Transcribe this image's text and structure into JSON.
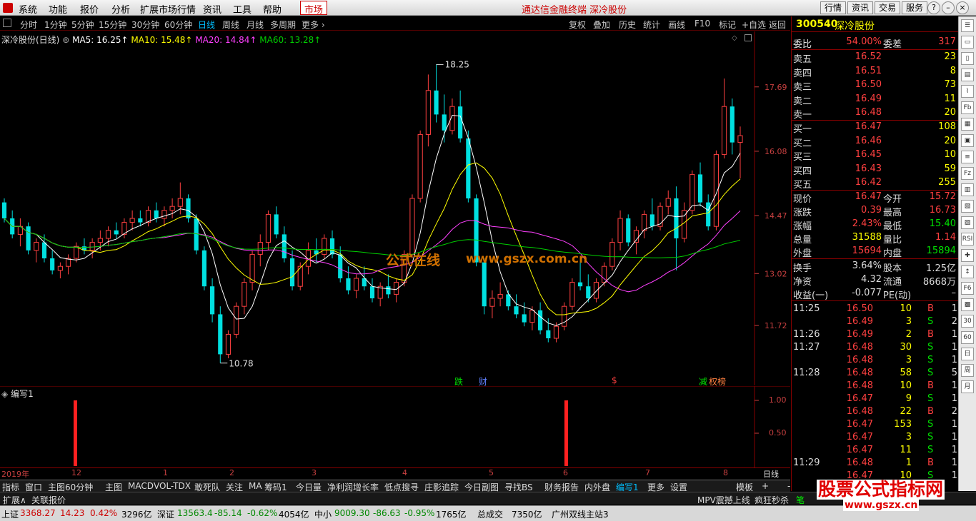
{
  "menu": [
    "系统",
    "功能",
    "报价",
    "分析",
    "扩展市场行情",
    "资讯",
    "工具",
    "帮助"
  ],
  "market_label": "市场",
  "window_title": "通达信金融终端  深冷股份",
  "top_right_buttons": [
    "行情",
    "资讯",
    "交易",
    "服务"
  ],
  "window_controls": [
    "?",
    "–",
    "□",
    "×"
  ],
  "periods": [
    "分时",
    "1分钟",
    "5分钟",
    "15分钟",
    "30分钟",
    "60分钟",
    "日线",
    "周线",
    "月线",
    "多周期",
    "更多 ›"
  ],
  "active_period": "日线",
  "chart_tools": [
    "复权",
    "叠加",
    "历史",
    "统计",
    "画线",
    "F10",
    "标记",
    "+自选",
    "返回"
  ],
  "ma_header": {
    "name": "深冷股份(日线)",
    "ma5": "MA5: 16.25↑",
    "ma10": "MA10: 15.48↑",
    "ma20": "MA20: 14.84↑",
    "ma60": "MA60: 13.28↑"
  },
  "colors": {
    "up": "#ff4040",
    "down": "#00e0e0",
    "ma5": "#ffffff",
    "ma10": "#ffff00",
    "ma20": "#ff40ff",
    "ma60": "#00d000",
    "axis": "#c84040",
    "accent": "#00bfff"
  },
  "chart_data": {
    "type": "candlestick",
    "price_axis_labels": [
      "17.69",
      "16.08",
      "14.47",
      "13.02",
      "11.72"
    ],
    "price_axis_values": [
      17.69,
      16.08,
      14.47,
      13.02,
      11.72
    ],
    "ylim": [
      10.4,
      18.9
    ],
    "high_annotation": "18.25",
    "low_annotation": "10.78",
    "x_month_labels": [
      "2019年",
      "12",
      "1",
      "2",
      "3",
      "4",
      "5",
      "6",
      "7",
      "8"
    ],
    "event_markers": [
      "跌",
      "财",
      "$",
      "减",
      "权榜"
    ],
    "candles_ohlc": [
      [
        14.8,
        14.9,
        14.3,
        14.4
      ],
      [
        14.4,
        14.6,
        13.9,
        14.0
      ],
      [
        14.0,
        14.4,
        13.7,
        14.2
      ],
      [
        14.2,
        14.3,
        13.5,
        13.6
      ],
      [
        13.6,
        13.9,
        13.3,
        13.8
      ],
      [
        13.8,
        14.0,
        13.3,
        13.4
      ],
      [
        13.4,
        13.6,
        13.0,
        13.1
      ],
      [
        13.1,
        13.3,
        12.9,
        13.2
      ],
      [
        13.2,
        13.5,
        13.0,
        13.4
      ],
      [
        13.4,
        13.8,
        13.3,
        13.7
      ],
      [
        13.7,
        13.9,
        13.5,
        13.6
      ],
      [
        13.6,
        13.9,
        13.4,
        13.8
      ],
      [
        13.8,
        14.1,
        13.6,
        13.9
      ],
      [
        13.9,
        14.2,
        13.7,
        14.1
      ],
      [
        14.1,
        14.3,
        13.9,
        14.0
      ],
      [
        14.0,
        14.4,
        13.9,
        14.3
      ],
      [
        14.3,
        14.6,
        14.1,
        14.4
      ],
      [
        14.4,
        14.6,
        14.2,
        14.3
      ],
      [
        14.3,
        14.7,
        14.2,
        14.6
      ],
      [
        14.6,
        14.8,
        14.3,
        14.4
      ],
      [
        14.4,
        14.7,
        14.2,
        14.6
      ],
      [
        14.6,
        14.9,
        14.4,
        14.7
      ],
      [
        14.7,
        15.3,
        14.5,
        14.9
      ],
      [
        14.9,
        15.0,
        14.3,
        14.4
      ],
      [
        14.4,
        14.5,
        13.5,
        13.6
      ],
      [
        13.6,
        13.7,
        12.6,
        12.7
      ],
      [
        12.7,
        12.9,
        11.8,
        12.0
      ],
      [
        12.0,
        12.2,
        10.78,
        11.0
      ],
      [
        11.0,
        11.6,
        10.9,
        11.5
      ],
      [
        11.5,
        12.3,
        11.4,
        12.2
      ],
      [
        12.2,
        12.9,
        12.0,
        12.8
      ],
      [
        12.8,
        13.6,
        12.6,
        13.5
      ],
      [
        13.5,
        14.0,
        13.2,
        13.8
      ],
      [
        13.8,
        14.6,
        13.6,
        14.5
      ],
      [
        14.5,
        14.7,
        13.9,
        14.0
      ],
      [
        14.0,
        14.2,
        13.3,
        13.4
      ],
      [
        13.4,
        13.6,
        12.6,
        12.7
      ],
      [
        12.7,
        13.3,
        12.6,
        13.2
      ],
      [
        13.2,
        13.8,
        13.0,
        13.6
      ],
      [
        13.6,
        13.9,
        13.3,
        13.5
      ],
      [
        13.5,
        14.0,
        13.4,
        13.9
      ],
      [
        13.9,
        14.1,
        13.4,
        13.5
      ],
      [
        13.5,
        13.7,
        12.8,
        12.9
      ],
      [
        12.9,
        13.2,
        12.5,
        12.6
      ],
      [
        12.6,
        13.0,
        12.4,
        12.9
      ],
      [
        12.9,
        13.2,
        12.6,
        12.7
      ],
      [
        12.7,
        12.9,
        12.3,
        12.4
      ],
      [
        12.4,
        12.8,
        12.2,
        12.7
      ],
      [
        12.7,
        13.0,
        12.4,
        12.5
      ],
      [
        12.5,
        12.9,
        12.3,
        12.8
      ],
      [
        12.8,
        13.6,
        12.7,
        13.5
      ],
      [
        13.5,
        15.0,
        13.4,
        14.9
      ],
      [
        14.9,
        16.6,
        14.8,
        16.5
      ],
      [
        16.5,
        18.0,
        16.2,
        17.6
      ],
      [
        17.6,
        18.25,
        16.8,
        17.0
      ],
      [
        17.0,
        17.5,
        16.3,
        16.6
      ],
      [
        16.6,
        17.4,
        16.5,
        17.2
      ],
      [
        17.2,
        17.6,
        16.3,
        16.4
      ],
      [
        16.4,
        16.6,
        14.8,
        14.9
      ],
      [
        14.9,
        15.0,
        13.2,
        13.3
      ],
      [
        13.3,
        13.4,
        12.0,
        12.2
      ],
      [
        12.2,
        12.6,
        11.9,
        12.4
      ],
      [
        12.4,
        12.8,
        12.2,
        12.5
      ],
      [
        12.5,
        12.6,
        12.1,
        12.2
      ],
      [
        12.2,
        12.5,
        11.9,
        12.0
      ],
      [
        12.0,
        12.3,
        11.7,
        11.8
      ],
      [
        11.8,
        12.2,
        11.6,
        12.1
      ],
      [
        12.1,
        12.3,
        11.5,
        11.6
      ],
      [
        11.6,
        11.9,
        11.3,
        11.4
      ],
      [
        11.4,
        11.8,
        11.3,
        11.7
      ],
      [
        11.7,
        12.3,
        11.6,
        12.2
      ],
      [
        12.2,
        12.9,
        12.1,
        12.8
      ],
      [
        12.8,
        13.3,
        12.6,
        12.7
      ],
      [
        12.7,
        13.0,
        12.3,
        12.4
      ],
      [
        12.4,
        12.9,
        12.3,
        12.8
      ],
      [
        12.8,
        13.3,
        12.7,
        13.2
      ],
      [
        13.2,
        13.9,
        13.1,
        13.8
      ],
      [
        13.8,
        14.6,
        13.6,
        14.4
      ],
      [
        14.4,
        14.5,
        13.7,
        13.8
      ],
      [
        13.8,
        14.2,
        13.5,
        14.1
      ],
      [
        14.1,
        14.6,
        13.9,
        14.5
      ],
      [
        14.5,
        14.9,
        14.1,
        14.2
      ],
      [
        14.2,
        14.8,
        14.1,
        14.7
      ],
      [
        14.7,
        15.1,
        14.5,
        14.9
      ],
      [
        14.9,
        15.2,
        13.1,
        13.9
      ],
      [
        13.9,
        14.8,
        13.8,
        14.6
      ],
      [
        14.6,
        15.6,
        14.5,
        15.5
      ],
      [
        15.5,
        15.8,
        14.7,
        14.8
      ],
      [
        14.8,
        15.0,
        14.1,
        14.2
      ],
      [
        14.2,
        16.1,
        14.1,
        16.0
      ],
      [
        16.0,
        17.9,
        15.9,
        17.2
      ],
      [
        17.2,
        17.4,
        16.0,
        16.3
      ],
      [
        16.3,
        16.7,
        15.4,
        16.47
      ]
    ],
    "ma_values_at_end": {
      "MA5": 16.25,
      "MA10": 15.48,
      "MA20": 14.84,
      "MA60": 13.28
    }
  },
  "sub_chart": {
    "title": "编写1",
    "axis_labels": [
      "1.00",
      "0.50"
    ]
  },
  "x_axis_right_label": "日线",
  "indicator_tabs": [
    "指标",
    "窗口",
    "主图60分钟",
    "主图",
    "MACD",
    "VOL-TDX",
    "敢死队",
    "关注",
    "MA",
    "筹码1",
    "今日量",
    "净利润增长率",
    "低点搜寻",
    "庄影追踪",
    "今日副图",
    "寻找BS",
    "财务报告",
    "内外盘",
    "编写1",
    "更多",
    "设置"
  ],
  "indicator_active": "编写1",
  "indicator_right": [
    "模板",
    "+",
    "-"
  ],
  "row2_left": [
    "扩展∧",
    "关联报价"
  ],
  "row2_right": [
    "MPV震撼上线",
    "疯狂秒杀",
    "笔"
  ],
  "status": {
    "sh_label": "上证",
    "sh_val": "3368.27",
    "sh_chg": "14.23",
    "sh_pct": "0.42%",
    "sh_amt": "3296亿",
    "sz_label": "深证",
    "sz_val": "13563.4",
    "sz_chg": "-85.14",
    "sz_pct": "-0.62%",
    "sz_amt": "4054亿",
    "zx_label": "中小",
    "zx_val": "9009.30",
    "zx_chg": "-86.63",
    "zx_pct": "-0.95%",
    "zx_amt": "1765亿",
    "total_label": "总成交",
    "total_amt": "7350亿",
    "station": "广州双线主站3"
  },
  "quote": {
    "code": "300540",
    "name": "深冷股份",
    "weibi_label": "委比",
    "weibi": "54.00%",
    "weicha_label": "委差",
    "weicha": "317",
    "asks": [
      [
        "卖五",
        "16.52",
        "23"
      ],
      [
        "卖四",
        "16.51",
        "8"
      ],
      [
        "卖三",
        "16.50",
        "73"
      ],
      [
        "卖二",
        "16.49",
        "11"
      ],
      [
        "卖一",
        "16.48",
        "20"
      ]
    ],
    "bids": [
      [
        "买一",
        "16.47",
        "108"
      ],
      [
        "买二",
        "16.46",
        "20"
      ],
      [
        "买三",
        "16.45",
        "10"
      ],
      [
        "买四",
        "16.43",
        "59"
      ],
      [
        "买五",
        "16.42",
        "255"
      ]
    ],
    "stats": [
      [
        "现价",
        "16.47",
        "今开",
        "15.72"
      ],
      [
        "涨跌",
        "0.39",
        "最高",
        "16.73"
      ],
      [
        "涨幅",
        "2.43%",
        "最低",
        "15.40"
      ],
      [
        "总量",
        "31588",
        "量比",
        "1.14"
      ],
      [
        "外盘",
        "15694",
        "内盘",
        "15894"
      ]
    ],
    "stats2": [
      [
        "换手",
        "3.64%",
        "股本",
        "1.25亿"
      ],
      [
        "净资",
        "4.32",
        "流通",
        "8668万"
      ],
      [
        "收益(一)",
        "-0.077",
        "PE(动)",
        "–"
      ]
    ],
    "ticks": [
      [
        "11:25",
        "16.50",
        "10",
        "B",
        "1"
      ],
      [
        "",
        "16.49",
        "3",
        "S",
        "2"
      ],
      [
        "11:26",
        "16.49",
        "2",
        "B",
        "1"
      ],
      [
        "11:27",
        "16.48",
        "30",
        "S",
        "1"
      ],
      [
        "",
        "16.48",
        "3",
        "S",
        "1"
      ],
      [
        "11:28",
        "16.48",
        "58",
        "S",
        "5"
      ],
      [
        "",
        "16.48",
        "10",
        "B",
        "1"
      ],
      [
        "",
        "16.47",
        "9",
        "S",
        "1"
      ],
      [
        "",
        "16.48",
        "22",
        "B",
        "2"
      ],
      [
        "",
        "16.47",
        "153",
        "S",
        "1"
      ],
      [
        "",
        "16.47",
        "3",
        "S",
        "1"
      ],
      [
        "",
        "16.47",
        "11",
        "S",
        "1"
      ],
      [
        "11:29",
        "16.48",
        "1",
        "B",
        "1"
      ],
      [
        "",
        "16.47",
        "10",
        "S",
        "1"
      ]
    ]
  },
  "watermark_center": {
    "a": "公式在线",
    "b": "www.gszx.com.cn"
  },
  "watermark_corner": {
    "a": "股票公式指标网",
    "b": "www.gszx.cn"
  },
  "right_tools": [
    "☰",
    "▭",
    "▯",
    "▤",
    "⌇",
    "Fb",
    "▦",
    "▣",
    "≡",
    "Fz",
    "▥",
    "▧",
    "▨",
    "RSI",
    "✚",
    "↕",
    "F6",
    "▩",
    "30",
    "60",
    "日",
    "周",
    "月"
  ]
}
